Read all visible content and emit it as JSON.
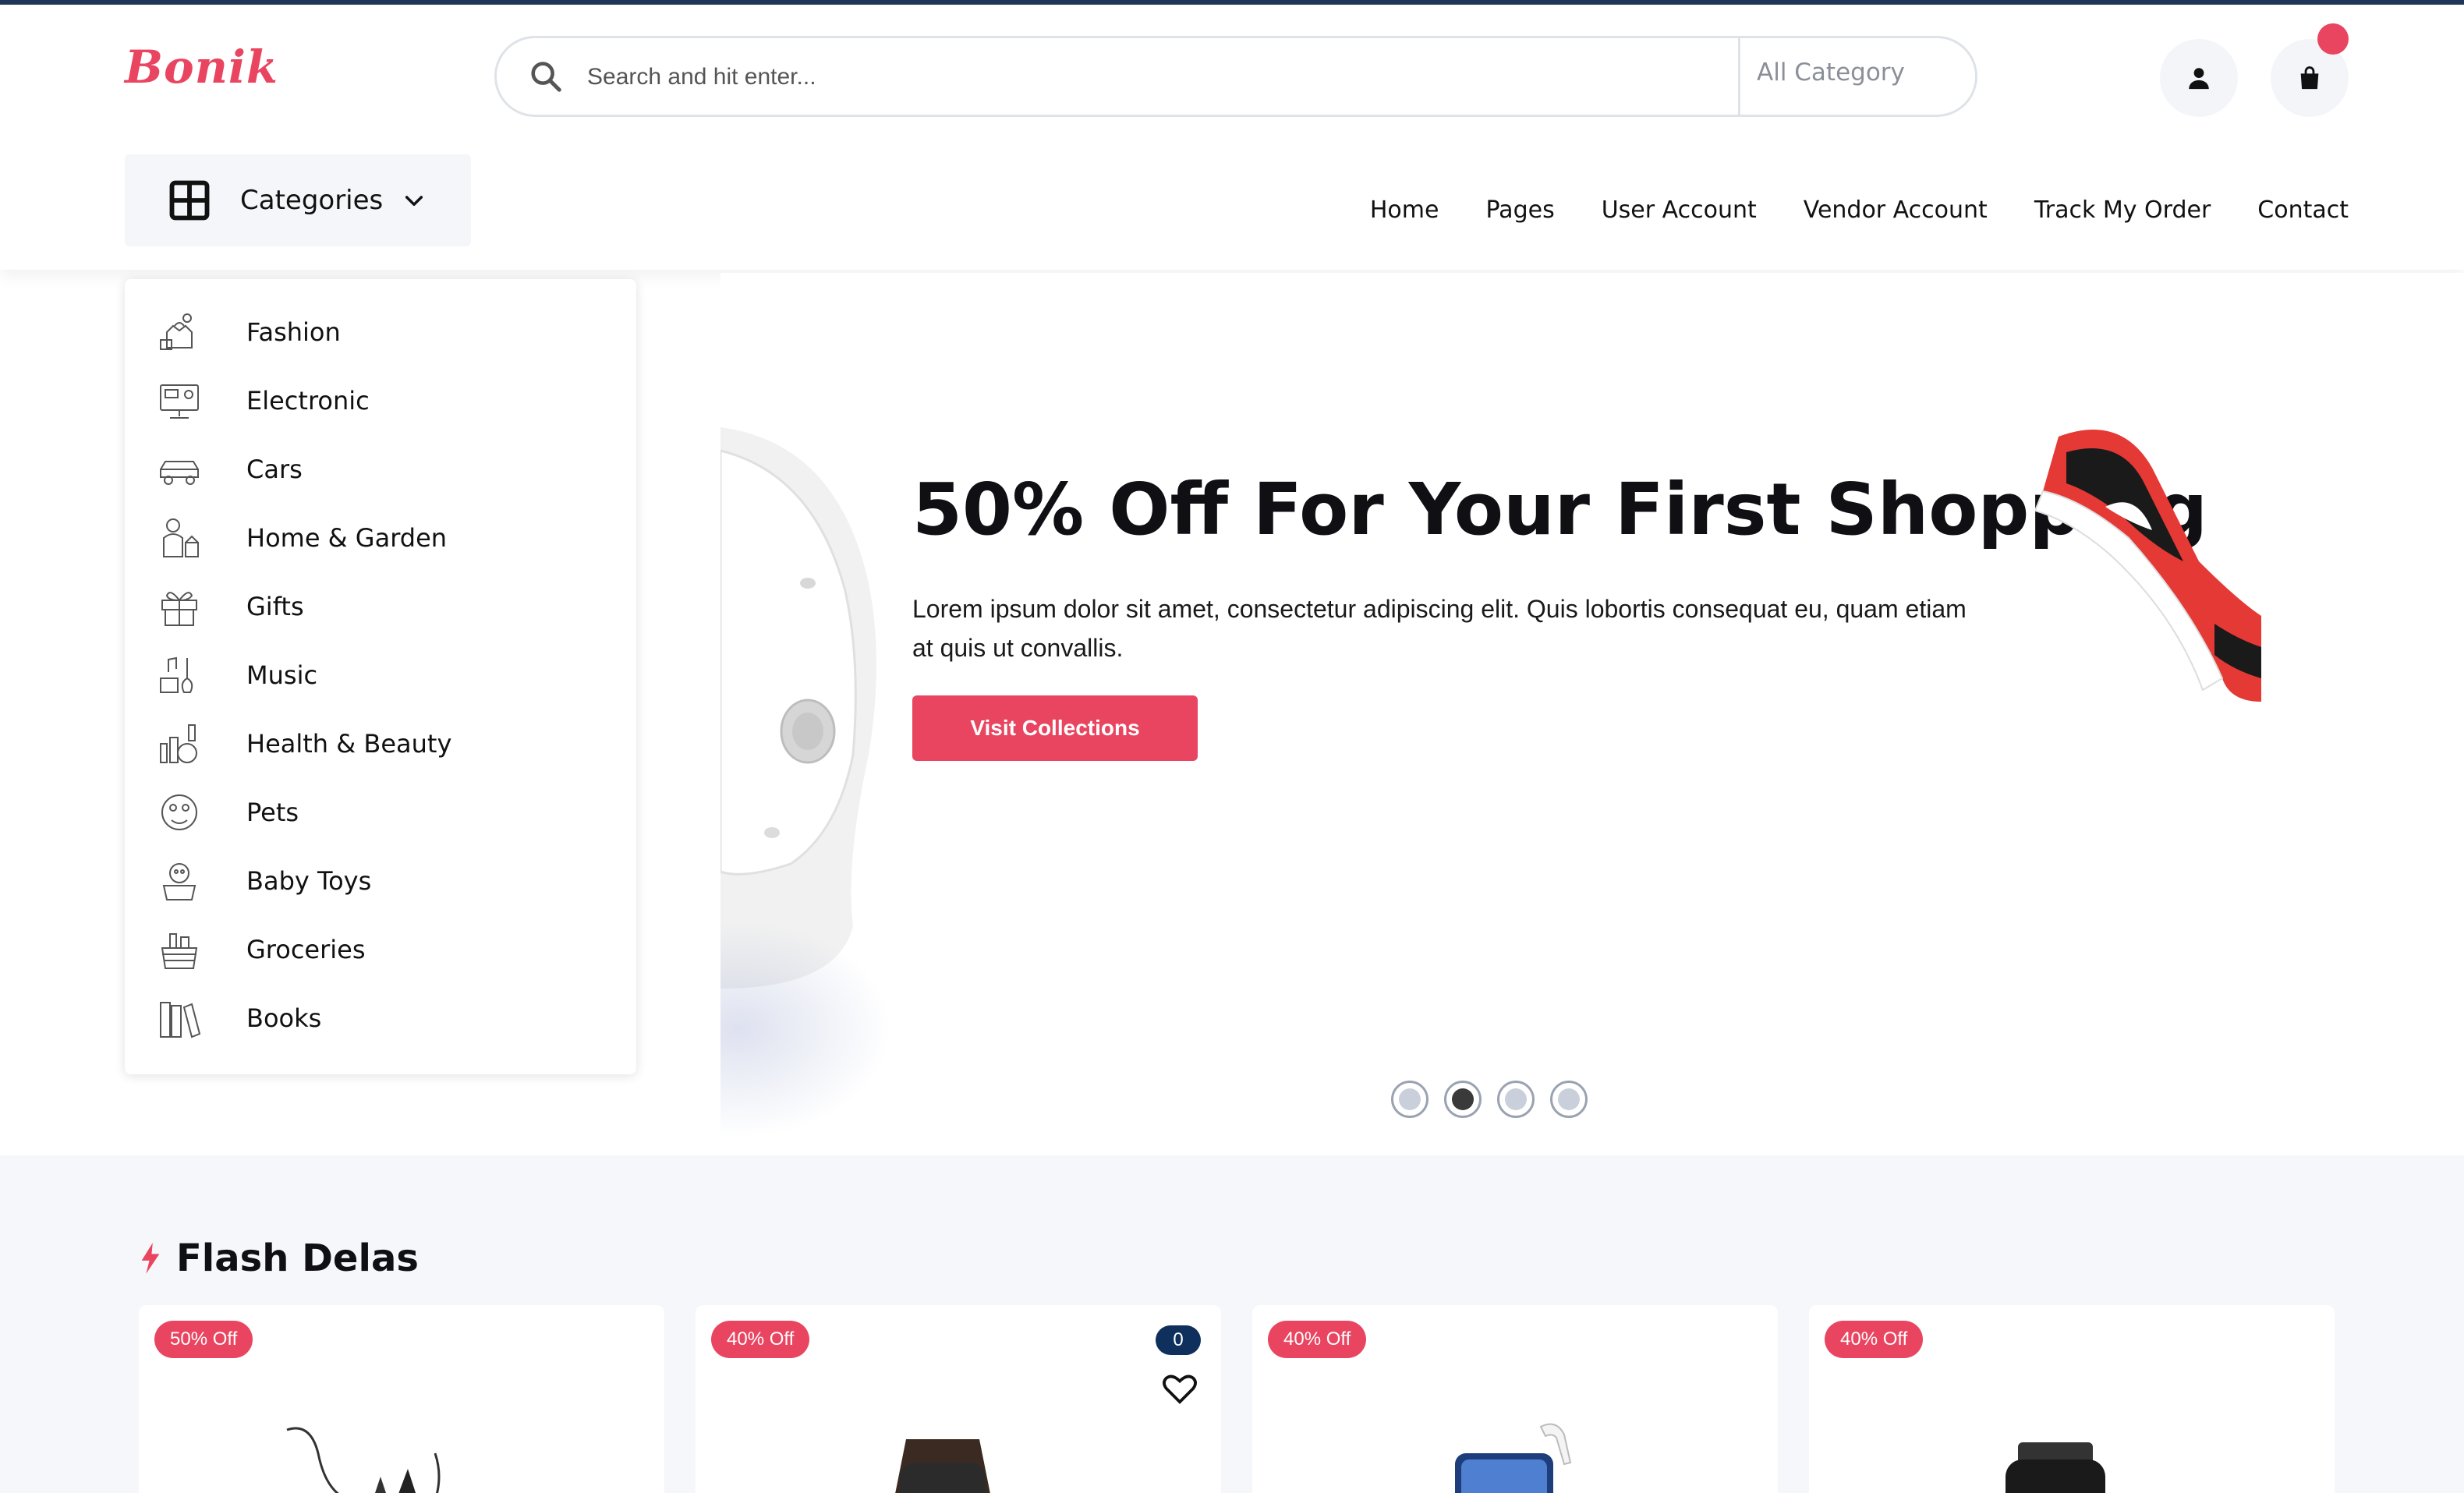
{
  "brand": {
    "logo": "Bonik",
    "accent_color": "#e94560",
    "navy_color": "#0f2f5c"
  },
  "search": {
    "placeholder": "Search and hit enter...",
    "category_select": "All Category"
  },
  "header_icons": {
    "user": "user-icon",
    "cart": "shopping-bag-icon"
  },
  "categories_button": {
    "label": "Categories"
  },
  "nav": [
    {
      "label": "Home"
    },
    {
      "label": "Pages"
    },
    {
      "label": "User Account"
    },
    {
      "label": "Vendor Account"
    },
    {
      "label": "Track My Order"
    },
    {
      "label": "Contact"
    }
  ],
  "categories": [
    {
      "label": "Fashion",
      "icon": "fashion-icon"
    },
    {
      "label": "Electronic",
      "icon": "electronic-icon"
    },
    {
      "label": "Cars",
      "icon": "car-icon"
    },
    {
      "label": "Home & Garden",
      "icon": "home-garden-icon"
    },
    {
      "label": "Gifts",
      "icon": "gift-icon"
    },
    {
      "label": "Music",
      "icon": "music-icon"
    },
    {
      "label": "Health & Beauty",
      "icon": "health-beauty-icon"
    },
    {
      "label": "Pets",
      "icon": "pets-icon"
    },
    {
      "label": "Baby Toys",
      "icon": "baby-toys-icon"
    },
    {
      "label": "Groceries",
      "icon": "groceries-icon"
    },
    {
      "label": "Books",
      "icon": "books-icon"
    }
  ],
  "hero": {
    "title": "50% Off For Your First Shopping",
    "text": "Lorem ipsum dolor sit amet, consectetur adipiscing elit. Quis lobortis consequat eu, quam etiam at quis ut convallis.",
    "button": "Visit Collections",
    "slides_total": 4,
    "active_slide": 2
  },
  "flash": {
    "title": "Flash Delas",
    "cards": [
      {
        "badge": "50% Off",
        "product": "headphones"
      },
      {
        "badge": "40% Off",
        "product": "watch",
        "cart_qty": "0"
      },
      {
        "badge": "40% Off",
        "product": "phone-airpods"
      },
      {
        "badge": "40% Off",
        "product": "smartwatch"
      }
    ]
  }
}
